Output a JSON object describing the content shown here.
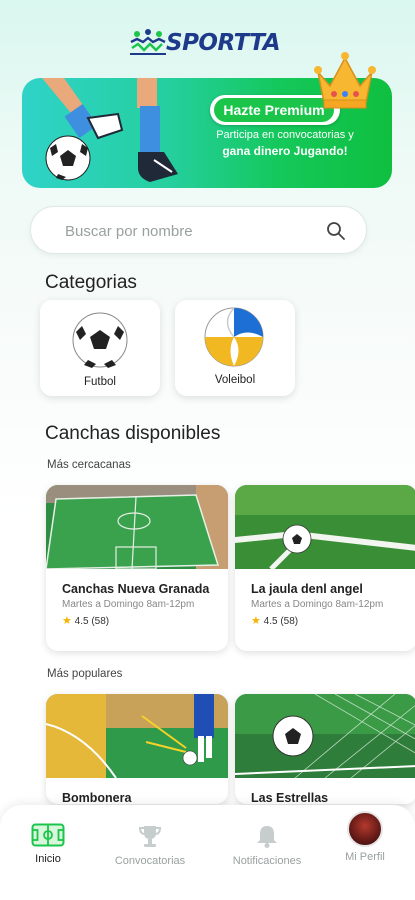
{
  "app": {
    "logo_text": "SPORT",
    "logo_text_accent": "TA"
  },
  "banner": {
    "pill_label": "Hazte Premium",
    "line1": "Participa en convocatorias y",
    "line2": "gana dinero Jugando!"
  },
  "search": {
    "placeholder": "Buscar por nombre"
  },
  "categories": {
    "title": "Categorias",
    "items": [
      {
        "label": "Futbol"
      },
      {
        "label": "Voleibol"
      }
    ]
  },
  "courts": {
    "title": "Canchas disponibles",
    "nearest": {
      "title": "Más cercacanas",
      "items": [
        {
          "name": "Canchas Nueva Granada",
          "hours": "Martes a Domingo  8am-12pm",
          "rating": "4.5 (58)"
        },
        {
          "name": "La jaula denl angel",
          "hours": "Martes a Domingo  8am-12pm",
          "rating": "4.5 (58)"
        }
      ]
    },
    "popular": {
      "title": "Más populares",
      "items": [
        {
          "name": "Bombonera"
        },
        {
          "name": "Las Estrellas"
        }
      ]
    }
  },
  "nav": {
    "items": [
      {
        "label": "Inicio"
      },
      {
        "label": "Convocatorias"
      },
      {
        "label": "Notificaciones"
      },
      {
        "label": "Mi Perfil"
      }
    ]
  },
  "colors": {
    "accent": "#1bc54a",
    "brand_blue": "#1e3a8a",
    "star": "#f5b301"
  }
}
